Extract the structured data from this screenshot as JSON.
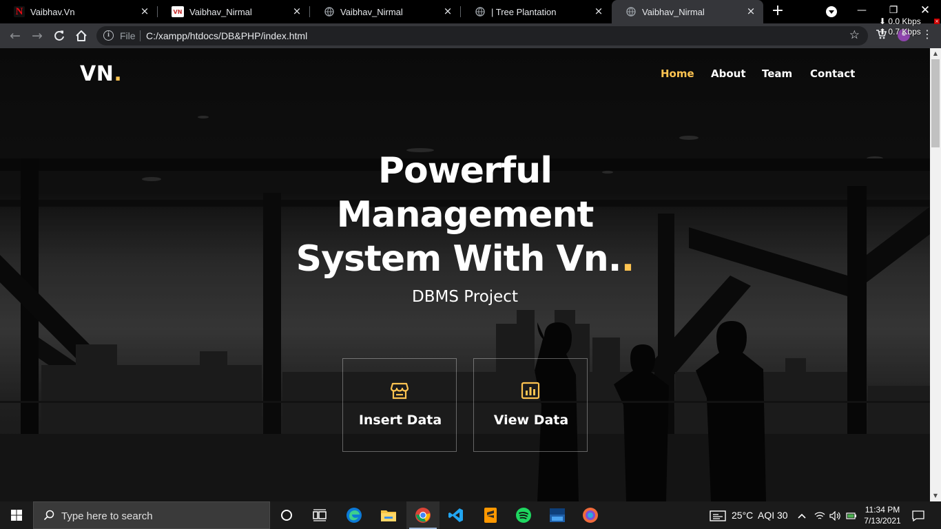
{
  "browser": {
    "tabs": [
      {
        "title": "Vaibhav.Vn",
        "favicon": "netflix-n-icon",
        "active": false
      },
      {
        "title": "Vaibhav_Nirmal",
        "favicon": "vn-red-logo-icon",
        "active": false
      },
      {
        "title": "Vaibhav_Nirmal",
        "favicon": "globe-icon",
        "active": false
      },
      {
        "title": "| Tree Plantation",
        "favicon": "globe-icon",
        "active": false
      },
      {
        "title": "Vaibhav_Nirmal",
        "favicon": "globe-icon",
        "active": true
      }
    ],
    "address": {
      "scheme_label": "File",
      "url": "C:/xampp/htdocs/DB&PHP/index.html"
    },
    "net_speed": {
      "down": "0.0 Kbps",
      "up": "0.7 Kbps"
    }
  },
  "site": {
    "logo_text": "VN",
    "logo_dot": ".",
    "nav": [
      {
        "label": "Home",
        "active": true
      },
      {
        "label": "About",
        "active": false
      },
      {
        "label": "Team",
        "active": false
      },
      {
        "label": "Contact",
        "active": false
      }
    ],
    "hero": {
      "title_line1": "Powerful",
      "title_line2": "Management",
      "title_line3": "System With Vn.",
      "title_accent": ".",
      "subtitle": "DBMS Project"
    },
    "actions": [
      {
        "label": "Insert Data",
        "icon": "store-icon"
      },
      {
        "label": "View Data",
        "icon": "bar-chart-icon"
      }
    ],
    "accent_color": "#ffc451"
  },
  "taskbar": {
    "search_placeholder": "Type here to search",
    "weather": "25°C",
    "aqi": "AQI 30",
    "time": "11:34 PM",
    "date": "7/13/2021",
    "apps": [
      "cortana-icon",
      "task-view-icon",
      "edge-icon",
      "file-explorer-icon",
      "chrome-icon",
      "vscode-icon",
      "sublime-text-icon",
      "spotify-icon",
      "dev-c-icon",
      "chromium-icon"
    ]
  }
}
